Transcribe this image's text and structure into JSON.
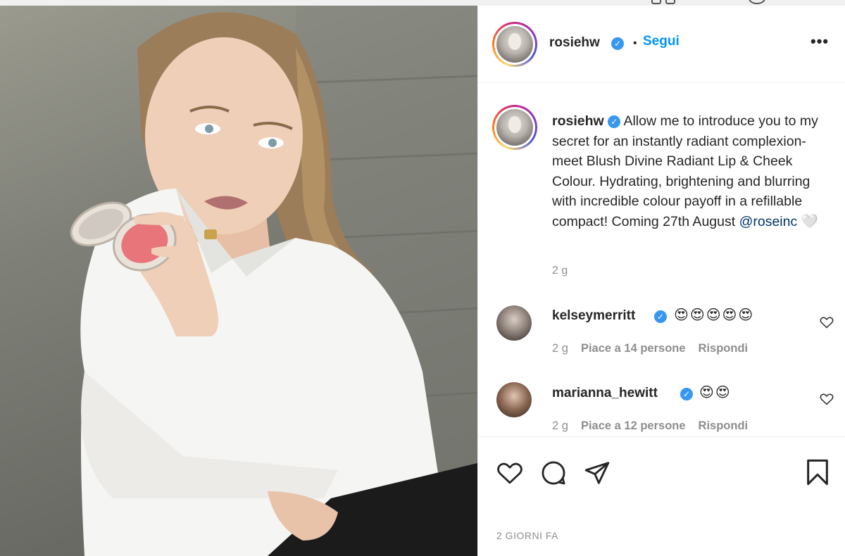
{
  "post": {
    "username": "rosiehw",
    "follow_label": "Segui",
    "separator": "•",
    "more_label": "•••",
    "caption_username": "rosiehw",
    "caption_text": " Allow me to introduce you to my secret for an instantly radiant complexion- meet Blush Divine Radiant Lip & Cheek Colour. Hydrating, brightening and blurring with incredible colour payoff in a refillable compact! Coming 27th August ",
    "caption_mention": "@roseinc",
    "caption_emoji": " 🤍",
    "caption_time": "2 g",
    "date_label": "2 GIORNI FA"
  },
  "comments": [
    {
      "username": "kelseymerritt",
      "text": "😍😍😍😍😍",
      "time": "2 g",
      "likes": "Piace a 14 persone",
      "reply": "Rispondi"
    },
    {
      "username": "marianna_hewitt",
      "text": "😍😍",
      "time": "2 g",
      "likes": "Piace a 12 persone",
      "reply": "Rispondi"
    }
  ],
  "icons": {
    "verified": "✓",
    "like": "heart-icon",
    "comment": "comment-icon",
    "share": "share-icon",
    "save": "bookmark-icon"
  },
  "colors": {
    "link_blue": "#0095f6",
    "verified_blue": "#3897f0",
    "mention": "#00376b",
    "muted": "#8e8e8e"
  }
}
